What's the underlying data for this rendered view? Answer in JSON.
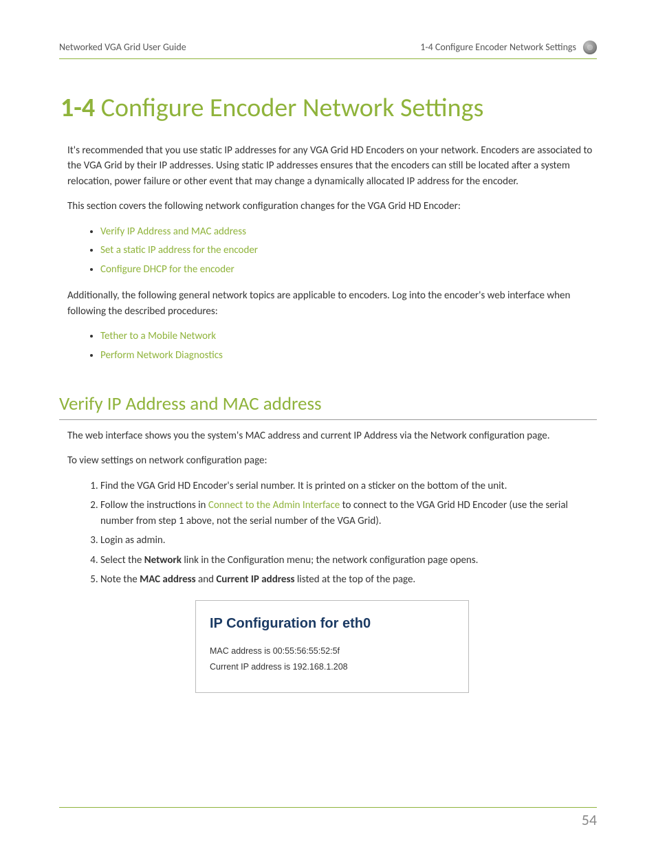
{
  "header": {
    "left": "Networked VGA Grid User Guide",
    "right": "1-4 Configure Encoder Network Settings",
    "icon": "settings-icon"
  },
  "title": {
    "prefix": "1-4",
    "text": "Configure Encoder Network Settings"
  },
  "intro1": "It's recommended that you use static IP addresses for any VGA Grid HD Encoders on your network. Encoders are associated to the VGA Grid by their IP addresses. Using static IP addresses ensures that the encoders can still be located after a system relocation, power failure or other event that may change a dynamically allocated IP address for the encoder.",
  "intro2": "This section covers the following network configuration changes for the VGA Grid HD Encoder:",
  "links1": [
    "Verify IP Address and MAC address",
    "Set a static IP address for the encoder",
    "Configure DHCP for the encoder"
  ],
  "intro3": "Additionally, the following general network topics are applicable to encoders. Log into the encoder's web interface when following the described procedures:",
  "links2": [
    "Tether to a Mobile Network",
    "Perform Network Diagnostics"
  ],
  "section": {
    "heading": "Verify IP Address and MAC address",
    "p1": "The web interface shows you the system's MAC address and current IP Address via the Network configuration page.",
    "p2": "To view settings on network configuration page:",
    "steps": {
      "s1": "Find the VGA Grid HD Encoder's serial number. It is printed on a sticker on the bottom of the unit.",
      "s2a": "Follow the instructions in ",
      "s2link": "Connect to the Admin Interface",
      "s2b": " to connect to the VGA Grid HD Encoder (use the serial number from step 1 above, not the serial number of the VGA Grid).",
      "s3": "Login as admin.",
      "s4a": "Select the ",
      "s4bold": "Network",
      "s4b": " link in the Configuration menu; the network configuration page opens.",
      "s5a": "Note the ",
      "s5bold1": "MAC address",
      "s5mid": " and ",
      "s5bold2": "Current IP address",
      "s5b": " listed at the top of the page."
    }
  },
  "ipbox": {
    "title": "IP Configuration for eth0",
    "mac_label": "MAC address is ",
    "mac_value": "00:55:56:55:52:5f",
    "ip_label": "Current IP address is ",
    "ip_value": "192.168.1.208"
  },
  "page_number": "54",
  "colors": {
    "accent": "#8fb33b",
    "ipbox_heading": "#1b3a63"
  }
}
